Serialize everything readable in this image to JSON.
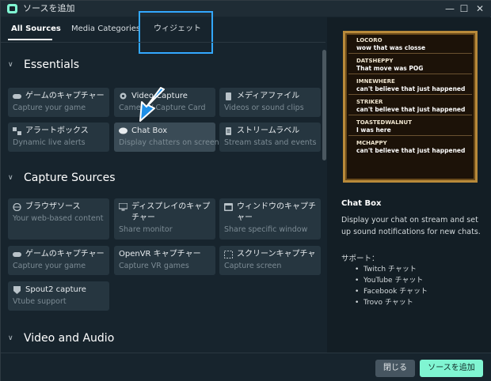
{
  "window": {
    "title": "ソースを追加"
  },
  "tabs": [
    {
      "label": "All Sources"
    },
    {
      "label": "Media Categories"
    },
    {
      "label": "ウィジェット"
    }
  ],
  "sections": [
    {
      "title": "Essentials",
      "cards": [
        {
          "name": "ゲームのキャプチャー",
          "desc": "Capture your game",
          "icon": "gamepad-icon"
        },
        {
          "name": "Video Capture",
          "desc": "Camera / Capture Card",
          "icon": "webcam-icon"
        },
        {
          "name": "メディアファイル",
          "desc": "Videos or sound clips",
          "icon": "file-icon"
        },
        {
          "name": "アラートボックス",
          "desc": "Dynamic live alerts",
          "icon": "alert-box-icon"
        },
        {
          "name": "Chat Box",
          "desc": "Display chatters on screen",
          "icon": "chat-icon"
        },
        {
          "name": "ストリームラベル",
          "desc": "Stream stats and events",
          "icon": "document-icon"
        }
      ]
    },
    {
      "title": "Capture Sources",
      "cards": [
        {
          "name": "ブラウザソース",
          "desc": "Your web-based content",
          "icon": "globe-icon"
        },
        {
          "name": "ディスプレイのキャプチャー",
          "desc": "Share monitor",
          "icon": "monitor-icon"
        },
        {
          "name": "ウィンドウのキャプチャー",
          "desc": "Share specific window",
          "icon": "window-icon"
        },
        {
          "name": "ゲームのキャプチャー",
          "desc": "Capture your game",
          "icon": "gamepad-icon"
        },
        {
          "name": "OpenVR キャプチャー",
          "desc": "Capture VR games",
          "icon": "vr-icon"
        },
        {
          "name": "スクリーンキャプチャ",
          "desc": "Capture screen",
          "icon": "screen-capture-icon"
        },
        {
          "name": "Spout2 capture",
          "desc": "Vtube support",
          "icon": "spout-icon"
        }
      ]
    },
    {
      "title": "Video and Audio"
    }
  ],
  "preview": {
    "chat": [
      {
        "user": "LOCORO",
        "msg": "wow that was closse"
      },
      {
        "user": "DATSHEPPY",
        "msg": "That move was POG"
      },
      {
        "user": "IMNEWHERE",
        "msg": "can't believe that just happened"
      },
      {
        "user": "STRIKER",
        "msg": "can't believe that just happened"
      },
      {
        "user": "TOASTEDWALNUT",
        "msg": "I was here"
      },
      {
        "user": "MCHAPPY",
        "msg": "can't believe that just happened"
      }
    ],
    "title": "Chat Box",
    "description": "Display your chat on stream and set up sound notifications for new chats.",
    "support_label": "サポート：",
    "support": [
      "Twitch チャット",
      "YouTube チャット",
      "Facebook チャット",
      "Trovo チャット"
    ]
  },
  "footer": {
    "close_label": "閉じる",
    "add_label": "ソースを追加"
  },
  "colors": {
    "accent": "#80f5d2",
    "highlight": "#33a8ff",
    "background": "#17242d",
    "card": "#263640"
  }
}
